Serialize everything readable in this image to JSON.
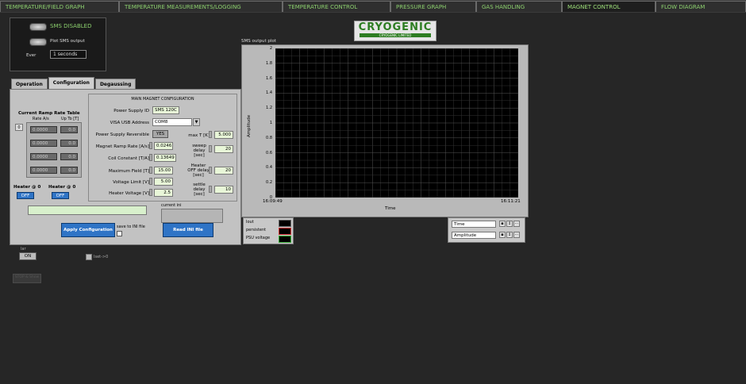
{
  "tabs": [
    {
      "label": "TEMPERATURE/FIELD GRAPH"
    },
    {
      "label": "TEMPERATURE MEASUREMENTS/LOGGING"
    },
    {
      "label": "TEMPERATURE CONTROL"
    },
    {
      "label": "PRESSURE GRAPH"
    },
    {
      "label": "GAS HANDLING"
    },
    {
      "label": "MAGNET CONTROL"
    },
    {
      "label": "FLOW DIAGRAM"
    }
  ],
  "sms": {
    "status": "SMS DISABLED",
    "plot_label": "Plot SMS output",
    "ever_label": "Ever",
    "ever_value": "1 seconds"
  },
  "logo": {
    "name": "CRYOGENIC",
    "sub": "CRYOGENIC LIMITED"
  },
  "plot": {
    "title": "SMS output plot",
    "ylabel": "Amplitude",
    "xlabel": "Time",
    "yticks": [
      "2",
      "1.8",
      "1.6",
      "1.4",
      "1.2",
      "1",
      "0.8",
      "0.6",
      "0.4",
      "0.2",
      "0"
    ],
    "x_start": "16:09:49",
    "x_end": "16:11:21"
  },
  "legend": [
    {
      "label": "Iout"
    },
    {
      "label": "persistent"
    },
    {
      "label": "PSU voltage"
    }
  ],
  "cursor": {
    "x_field": "Time",
    "y_field": "Amplitude"
  },
  "config_tabs": [
    {
      "label": "Operation"
    },
    {
      "label": "Configuration"
    },
    {
      "label": "Degaussing"
    }
  ],
  "ramp_table": {
    "title": "Current Ramp Rate Table",
    "col1": "Rate A/s",
    "col2": "Up To [T]",
    "index": "0",
    "rows": [
      {
        "rate": "0.0000",
        "upto": "0.0"
      },
      {
        "rate": "0.0000",
        "upto": "0.0"
      },
      {
        "rate": "0.0000",
        "upto": "0.0"
      },
      {
        "rate": "0.0000",
        "upto": "0.0"
      }
    ]
  },
  "main_config": {
    "title": "MAIN MAGNET CONFIGURATION",
    "psu_id_label": "Power Supply ID",
    "psu_id": "SMS 120C",
    "visa_label": "VISA USB Address",
    "visa_value": "COM8",
    "reversible_label": "Power Supply Reversible",
    "reversible_value": "YES",
    "maxT_label": "max T [K]",
    "maxT_value": "5.000",
    "ramp_label": "Magnet Ramp Rate [A/s]",
    "ramp_value": "0.0246",
    "sweep_label": "sweep delay [sec]",
    "sweep_value": "20",
    "coil_label": "Coil Constant [T/A]",
    "coil_value": "0.13649",
    "maxfield_label": "Maximum Field [T]",
    "maxfield_value": "15.00",
    "heateroff_label": "Heater OFF delay [sec]",
    "heateroff_value": "20",
    "vlimit_label": "Voltage Limit [V]",
    "vlimit_value": "5.00",
    "hvolt_label": "Heater Voltage [V]",
    "hvolt_value": "2.5",
    "settle_label": "settle delay [sec]",
    "settle_value": "10"
  },
  "heaters": [
    {
      "label": "Heater @ 0",
      "state": "OFF"
    },
    {
      "label": "Heater @ 0",
      "state": "OFF"
    }
  ],
  "current_ini_label": "current ini",
  "apply_label": "Apply Configuration",
  "save_ini_label": "save to INI file",
  "read_ini_label": "Read INI file",
  "bottom": {
    "toggle_label": "lar",
    "toggle_state": "ON",
    "checkbox_label": "Iset->0",
    "faded_button": "STOP & Show"
  }
}
